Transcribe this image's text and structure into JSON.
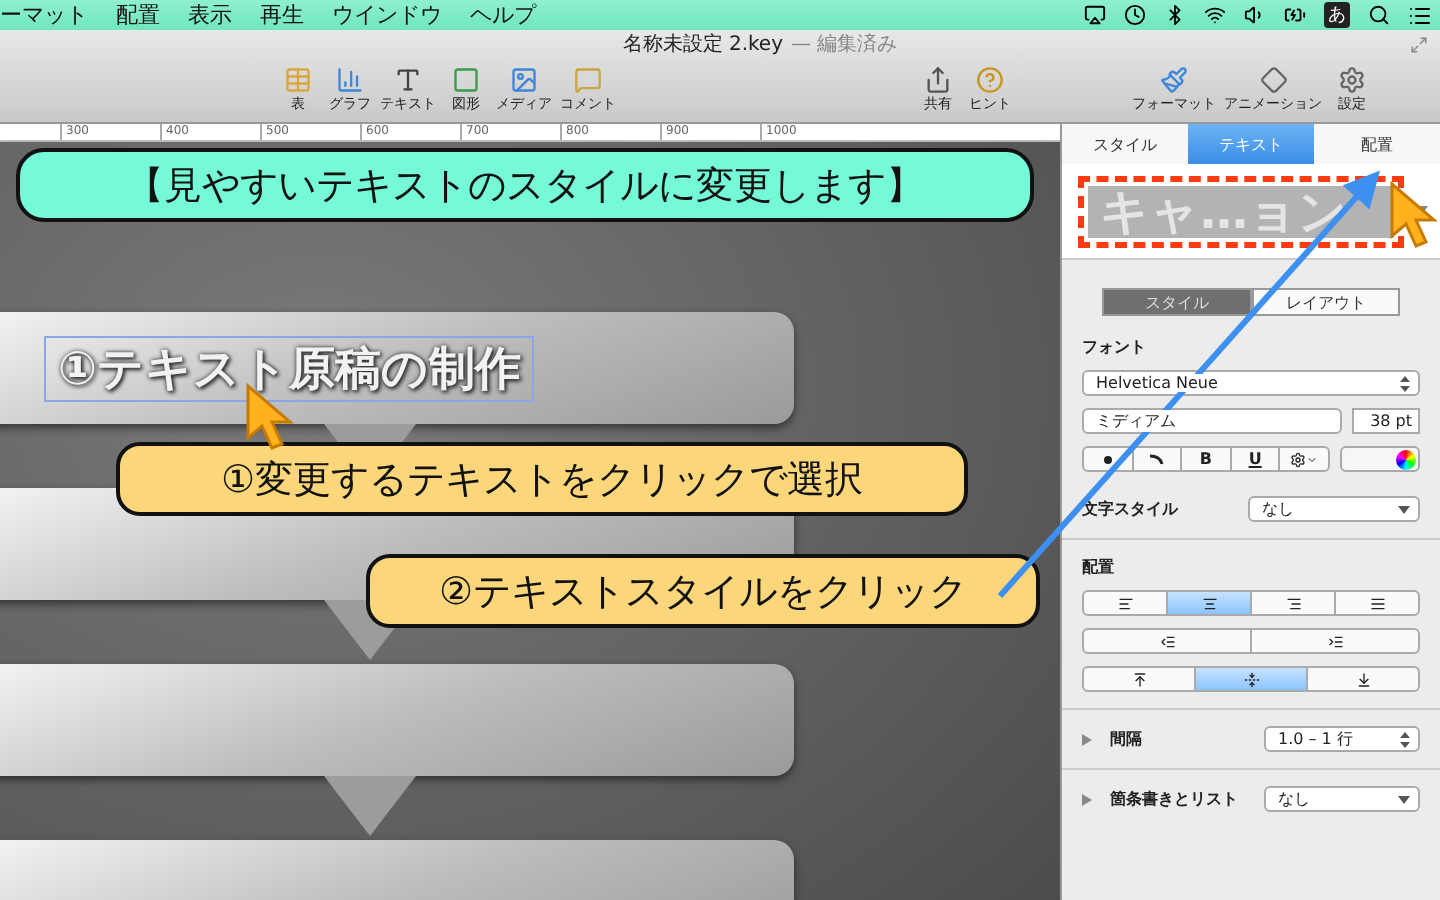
{
  "menubar": {
    "items": [
      "ーマット",
      "配置",
      "表示",
      "再生",
      "ウインドウ",
      "ヘルプ"
    ],
    "input_method": "あ"
  },
  "window": {
    "title": "名称未設定 2.key",
    "status": "— 編集済み"
  },
  "toolbar": {
    "groups": [
      [
        {
          "kind": "table",
          "label": "表"
        },
        {
          "kind": "chart",
          "label": "グラフ"
        },
        {
          "kind": "text",
          "label": "テキスト"
        },
        {
          "kind": "shape",
          "label": "図形"
        },
        {
          "kind": "media",
          "label": "メディア"
        },
        {
          "kind": "comment",
          "label": "コメント"
        }
      ],
      [
        {
          "kind": "share",
          "label": "共有"
        },
        {
          "kind": "hint",
          "label": "ヒント"
        }
      ],
      [
        {
          "kind": "format",
          "label": "フォーマット"
        },
        {
          "kind": "animate",
          "label": "アニメーション"
        },
        {
          "kind": "settings",
          "label": "設定"
        }
      ]
    ]
  },
  "ruler": {
    "ticks": [
      "300",
      "400",
      "500",
      "600",
      "700",
      "800",
      "900",
      "1000"
    ]
  },
  "canvas": {
    "banner": "【見やすいテキストのスタイルに変更します】",
    "slides": [
      {
        "kind": "titled",
        "title": "①テキスト原稿の制作",
        "selected": true
      },
      {
        "kind": "blank"
      },
      {
        "kind": "blank"
      },
      {
        "kind": "blank"
      }
    ]
  },
  "callouts": [
    "①変更するテキストをクリックで選択",
    "②テキストスタイルをクリック"
  ],
  "inspector": {
    "tabs": [
      {
        "label": "スタイル",
        "selected": false
      },
      {
        "label": "テキスト",
        "selected": true
      },
      {
        "label": "配置",
        "selected": false
      }
    ],
    "style_preview": "キャ…ョン",
    "segments": [
      {
        "label": "スタイル",
        "selected": true
      },
      {
        "label": "レイアウト",
        "selected": false
      }
    ],
    "font_label": "フォント",
    "font_family": "Helvetica Neue",
    "font_weight": "ミディアム",
    "font_size": "38 pt",
    "style_buttons": [
      {
        "kind": "dot"
      },
      {
        "kind": "curve"
      },
      {
        "kind": "bold",
        "label": "B"
      },
      {
        "kind": "underline",
        "label": "U"
      },
      {
        "kind": "gear"
      }
    ],
    "char_style": {
      "label": "文字スタイル",
      "value": "なし"
    },
    "alignment_label": "配置",
    "align_rows": [
      [
        {
          "kind": "left",
          "selected": false
        },
        {
          "kind": "center",
          "selected": true
        },
        {
          "kind": "right",
          "selected": false
        },
        {
          "kind": "justify",
          "selected": false
        }
      ],
      [
        {
          "kind": "outdent",
          "selected": false
        },
        {
          "kind": "indent",
          "selected": false
        }
      ],
      [
        {
          "kind": "top",
          "selected": false
        },
        {
          "kind": "middle",
          "selected": true
        },
        {
          "kind": "bottom",
          "selected": false
        }
      ]
    ],
    "spacing": {
      "label": "間隔",
      "value": "1.0 – 1 行",
      "expanded": false
    },
    "bullets": {
      "label": "箇条書きとリスト",
      "value": "なし",
      "expanded": false
    }
  }
}
